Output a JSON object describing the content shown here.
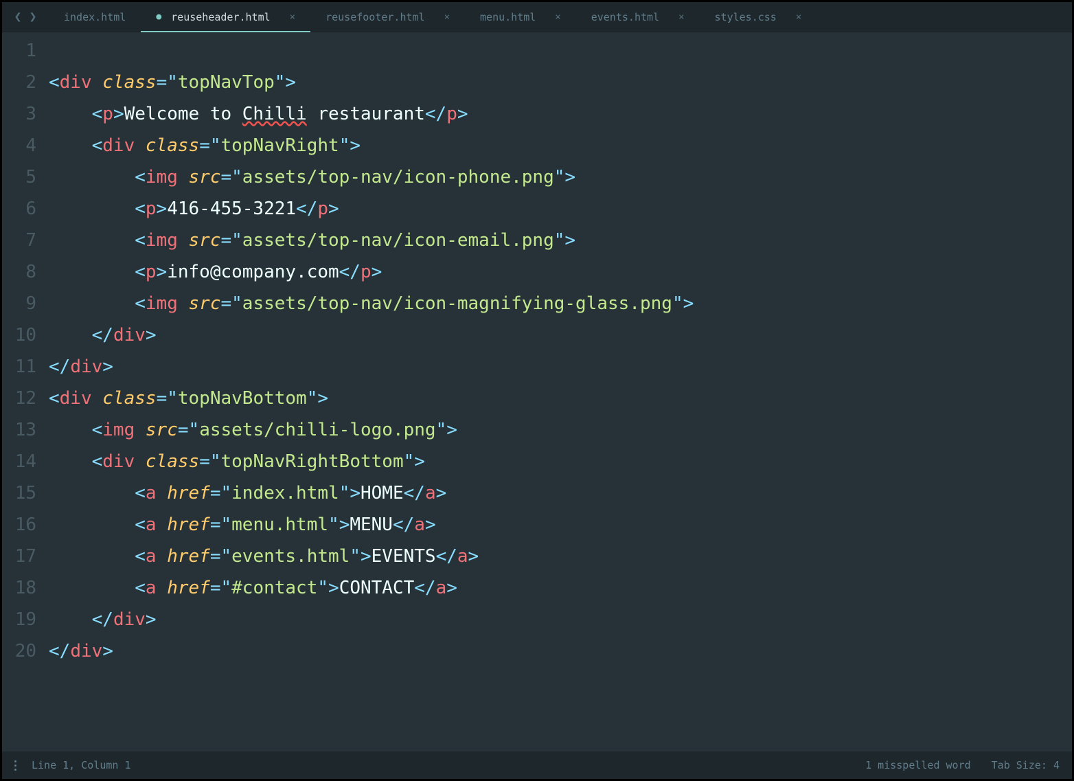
{
  "tabs": [
    {
      "label": "index.html",
      "modified": false,
      "active": false,
      "closeable": false
    },
    {
      "label": "reuseheader.html",
      "modified": true,
      "active": true,
      "closeable": true
    },
    {
      "label": "reusefooter.html",
      "modified": false,
      "active": false,
      "closeable": true
    },
    {
      "label": "menu.html",
      "modified": false,
      "active": false,
      "closeable": true
    },
    {
      "label": "events.html",
      "modified": false,
      "active": false,
      "closeable": true
    },
    {
      "label": "styles.css",
      "modified": false,
      "active": false,
      "closeable": true
    }
  ],
  "code": {
    "lines": [
      {
        "n": 1,
        "indent": 0,
        "tokens": []
      },
      {
        "n": 2,
        "indent": 0,
        "tokens": [
          {
            "t": "punct",
            "v": "<"
          },
          {
            "t": "tagnm",
            "v": "div"
          },
          {
            "t": "txt",
            "v": " "
          },
          {
            "t": "attr",
            "v": "class"
          },
          {
            "t": "punct",
            "v": "="
          },
          {
            "t": "punct",
            "v": "\""
          },
          {
            "t": "string",
            "v": "topNavTop"
          },
          {
            "t": "punct",
            "v": "\""
          },
          {
            "t": "punct",
            "v": ">"
          }
        ]
      },
      {
        "n": 3,
        "indent": 1,
        "tokens": [
          {
            "t": "punct",
            "v": "<"
          },
          {
            "t": "tagnm",
            "v": "p"
          },
          {
            "t": "punct",
            "v": ">"
          },
          {
            "t": "txt",
            "v": "Welcome to "
          },
          {
            "t": "txt",
            "v": "Chilli",
            "spell": true
          },
          {
            "t": "txt",
            "v": " restaurant"
          },
          {
            "t": "punct",
            "v": "</"
          },
          {
            "t": "tagnm",
            "v": "p"
          },
          {
            "t": "punct",
            "v": ">"
          }
        ]
      },
      {
        "n": 4,
        "indent": 1,
        "tokens": [
          {
            "t": "punct",
            "v": "<"
          },
          {
            "t": "tagnm",
            "v": "div"
          },
          {
            "t": "txt",
            "v": " "
          },
          {
            "t": "attr",
            "v": "class"
          },
          {
            "t": "punct",
            "v": "="
          },
          {
            "t": "punct",
            "v": "\""
          },
          {
            "t": "string",
            "v": "topNavRight"
          },
          {
            "t": "punct",
            "v": "\""
          },
          {
            "t": "punct",
            "v": ">"
          }
        ]
      },
      {
        "n": 5,
        "indent": 2,
        "tokens": [
          {
            "t": "punct",
            "v": "<"
          },
          {
            "t": "tagnm",
            "v": "img"
          },
          {
            "t": "txt",
            "v": " "
          },
          {
            "t": "attr",
            "v": "src"
          },
          {
            "t": "punct",
            "v": "="
          },
          {
            "t": "punct",
            "v": "\""
          },
          {
            "t": "string",
            "v": "assets/top-nav/icon-phone.png"
          },
          {
            "t": "punct",
            "v": "\""
          },
          {
            "t": "punct",
            "v": ">"
          }
        ]
      },
      {
        "n": 6,
        "indent": 2,
        "tokens": [
          {
            "t": "punct",
            "v": "<"
          },
          {
            "t": "tagnm",
            "v": "p"
          },
          {
            "t": "punct",
            "v": ">"
          },
          {
            "t": "txt",
            "v": "416-455-3221"
          },
          {
            "t": "punct",
            "v": "</"
          },
          {
            "t": "tagnm",
            "v": "p"
          },
          {
            "t": "punct",
            "v": ">"
          }
        ]
      },
      {
        "n": 7,
        "indent": 2,
        "tokens": [
          {
            "t": "punct",
            "v": "<"
          },
          {
            "t": "tagnm",
            "v": "img"
          },
          {
            "t": "txt",
            "v": " "
          },
          {
            "t": "attr",
            "v": "src"
          },
          {
            "t": "punct",
            "v": "="
          },
          {
            "t": "punct",
            "v": "\""
          },
          {
            "t": "string",
            "v": "assets/top-nav/icon-email.png"
          },
          {
            "t": "punct",
            "v": "\""
          },
          {
            "t": "punct",
            "v": ">"
          }
        ]
      },
      {
        "n": 8,
        "indent": 2,
        "tokens": [
          {
            "t": "punct",
            "v": "<"
          },
          {
            "t": "tagnm",
            "v": "p"
          },
          {
            "t": "punct",
            "v": ">"
          },
          {
            "t": "txt",
            "v": "info@company.com"
          },
          {
            "t": "punct",
            "v": "</"
          },
          {
            "t": "tagnm",
            "v": "p"
          },
          {
            "t": "punct",
            "v": ">"
          }
        ]
      },
      {
        "n": 9,
        "indent": 2,
        "tokens": [
          {
            "t": "punct",
            "v": "<"
          },
          {
            "t": "tagnm",
            "v": "img"
          },
          {
            "t": "txt",
            "v": " "
          },
          {
            "t": "attr",
            "v": "src"
          },
          {
            "t": "punct",
            "v": "="
          },
          {
            "t": "punct",
            "v": "\""
          },
          {
            "t": "string",
            "v": "assets/top-nav/icon-magnifying-glass.png"
          },
          {
            "t": "punct",
            "v": "\""
          },
          {
            "t": "punct",
            "v": ">"
          }
        ]
      },
      {
        "n": 10,
        "indent": 1,
        "tokens": [
          {
            "t": "punct",
            "v": "</"
          },
          {
            "t": "tagnm",
            "v": "div"
          },
          {
            "t": "punct",
            "v": ">"
          }
        ]
      },
      {
        "n": 11,
        "indent": 0,
        "tokens": [
          {
            "t": "punct",
            "v": "</"
          },
          {
            "t": "tagnm",
            "v": "div"
          },
          {
            "t": "punct",
            "v": ">"
          }
        ]
      },
      {
        "n": 12,
        "indent": 0,
        "tokens": [
          {
            "t": "punct",
            "v": "<"
          },
          {
            "t": "tagnm",
            "v": "div"
          },
          {
            "t": "txt",
            "v": " "
          },
          {
            "t": "attr",
            "v": "class"
          },
          {
            "t": "punct",
            "v": "="
          },
          {
            "t": "punct",
            "v": "\""
          },
          {
            "t": "string",
            "v": "topNavBottom"
          },
          {
            "t": "punct",
            "v": "\""
          },
          {
            "t": "punct",
            "v": ">"
          }
        ]
      },
      {
        "n": 13,
        "indent": 1,
        "tokens": [
          {
            "t": "punct",
            "v": "<"
          },
          {
            "t": "tagnm",
            "v": "img"
          },
          {
            "t": "txt",
            "v": " "
          },
          {
            "t": "attr",
            "v": "src"
          },
          {
            "t": "punct",
            "v": "="
          },
          {
            "t": "punct",
            "v": "\""
          },
          {
            "t": "string",
            "v": "assets/chilli-logo.png"
          },
          {
            "t": "punct",
            "v": "\""
          },
          {
            "t": "punct",
            "v": ">"
          }
        ]
      },
      {
        "n": 14,
        "indent": 1,
        "tokens": [
          {
            "t": "punct",
            "v": "<"
          },
          {
            "t": "tagnm",
            "v": "div"
          },
          {
            "t": "txt",
            "v": " "
          },
          {
            "t": "attr",
            "v": "class"
          },
          {
            "t": "punct",
            "v": "="
          },
          {
            "t": "punct",
            "v": "\""
          },
          {
            "t": "string",
            "v": "topNavRightBottom"
          },
          {
            "t": "punct",
            "v": "\""
          },
          {
            "t": "punct",
            "v": ">"
          }
        ]
      },
      {
        "n": 15,
        "indent": 2,
        "tokens": [
          {
            "t": "punct",
            "v": "<"
          },
          {
            "t": "tagnm",
            "v": "a"
          },
          {
            "t": "txt",
            "v": " "
          },
          {
            "t": "attr",
            "v": "href"
          },
          {
            "t": "punct",
            "v": "="
          },
          {
            "t": "punct",
            "v": "\""
          },
          {
            "t": "string",
            "v": "index.html"
          },
          {
            "t": "punct",
            "v": "\""
          },
          {
            "t": "punct",
            "v": ">"
          },
          {
            "t": "txt",
            "v": "HOME"
          },
          {
            "t": "punct",
            "v": "</"
          },
          {
            "t": "tagnm",
            "v": "a"
          },
          {
            "t": "punct",
            "v": ">"
          }
        ]
      },
      {
        "n": 16,
        "indent": 2,
        "tokens": [
          {
            "t": "punct",
            "v": "<"
          },
          {
            "t": "tagnm",
            "v": "a"
          },
          {
            "t": "txt",
            "v": " "
          },
          {
            "t": "attr",
            "v": "href"
          },
          {
            "t": "punct",
            "v": "="
          },
          {
            "t": "punct",
            "v": "\""
          },
          {
            "t": "string",
            "v": "menu.html"
          },
          {
            "t": "punct",
            "v": "\""
          },
          {
            "t": "punct",
            "v": ">"
          },
          {
            "t": "txt",
            "v": "MENU"
          },
          {
            "t": "punct",
            "v": "</"
          },
          {
            "t": "tagnm",
            "v": "a"
          },
          {
            "t": "punct",
            "v": ">"
          }
        ]
      },
      {
        "n": 17,
        "indent": 2,
        "tokens": [
          {
            "t": "punct",
            "v": "<"
          },
          {
            "t": "tagnm",
            "v": "a"
          },
          {
            "t": "txt",
            "v": " "
          },
          {
            "t": "attr",
            "v": "href"
          },
          {
            "t": "punct",
            "v": "="
          },
          {
            "t": "punct",
            "v": "\""
          },
          {
            "t": "string",
            "v": "events.html"
          },
          {
            "t": "punct",
            "v": "\""
          },
          {
            "t": "punct",
            "v": ">"
          },
          {
            "t": "txt",
            "v": "EVENTS"
          },
          {
            "t": "punct",
            "v": "</"
          },
          {
            "t": "tagnm",
            "v": "a"
          },
          {
            "t": "punct",
            "v": ">"
          }
        ]
      },
      {
        "n": 18,
        "indent": 2,
        "tokens": [
          {
            "t": "punct",
            "v": "<"
          },
          {
            "t": "tagnm",
            "v": "a"
          },
          {
            "t": "txt",
            "v": " "
          },
          {
            "t": "attr",
            "v": "href"
          },
          {
            "t": "punct",
            "v": "="
          },
          {
            "t": "punct",
            "v": "\""
          },
          {
            "t": "string",
            "v": "#contact"
          },
          {
            "t": "punct",
            "v": "\""
          },
          {
            "t": "punct",
            "v": ">"
          },
          {
            "t": "txt",
            "v": "CONTACT"
          },
          {
            "t": "punct",
            "v": "</"
          },
          {
            "t": "tagnm",
            "v": "a"
          },
          {
            "t": "punct",
            "v": ">"
          }
        ]
      },
      {
        "n": 19,
        "indent": 1,
        "tokens": [
          {
            "t": "punct",
            "v": "</"
          },
          {
            "t": "tagnm",
            "v": "div"
          },
          {
            "t": "punct",
            "v": ">"
          }
        ]
      },
      {
        "n": 20,
        "indent": 0,
        "tokens": [
          {
            "t": "punct",
            "v": "</"
          },
          {
            "t": "tagnm",
            "v": "div"
          },
          {
            "t": "punct",
            "v": ">"
          }
        ]
      }
    ]
  },
  "statusbar": {
    "cursor": "Line 1, Column 1",
    "spelling": "1 misspelled word",
    "tabsize": "Tab Size: 4"
  }
}
